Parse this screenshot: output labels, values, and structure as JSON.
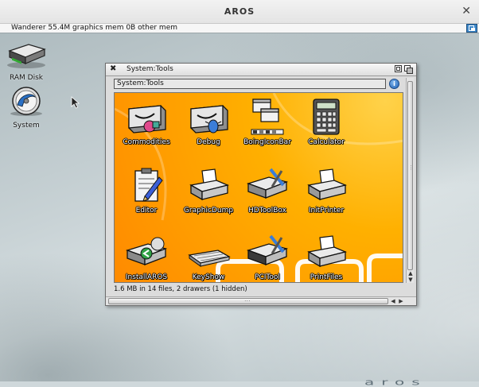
{
  "host": {
    "title": "AROS",
    "close_glyph": "✕"
  },
  "screenbar": {
    "text": "Wanderer 55.4M graphics mem 0B other mem",
    "depth_icon": "screen-depth-icon"
  },
  "desktop": {
    "icons": [
      {
        "label": "RAM Disk",
        "icon": "ram-disk-icon"
      },
      {
        "label": "System",
        "icon": "system-drive-icon"
      }
    ]
  },
  "window": {
    "title": "System:Tools",
    "path": "System:Tools",
    "close_glyph": "✖",
    "info_glyph": "i",
    "status": "1.6 MB in 14 files, 2 drawers (1 hidden)",
    "icons": [
      {
        "label": "Commodities",
        "icon": "drawer-icon"
      },
      {
        "label": "Debug",
        "icon": "drawer-icon"
      },
      {
        "label": "BoingIconBar",
        "icon": "boingiconbar-icon"
      },
      {
        "label": "Calculator",
        "icon": "calculator-icon"
      },
      {
        "label": "Editor",
        "icon": "editor-icon"
      },
      {
        "label": "GraphicDump",
        "icon": "printer-icon"
      },
      {
        "label": "HDToolBox",
        "icon": "hdtoolbox-icon"
      },
      {
        "label": "InitPrinter",
        "icon": "printer-icon"
      },
      {
        "label": "InstallAROS",
        "icon": "install-icon"
      },
      {
        "label": "KeyShow",
        "icon": "keyboard-icon"
      },
      {
        "label": "PCITool",
        "icon": "hdtoolbox-icon"
      },
      {
        "label": "PrintFiles",
        "icon": "printer-icon"
      }
    ],
    "scroll": {
      "up": "▲",
      "down": "▼",
      "left": "◀",
      "right": "▶"
    }
  },
  "brand": {
    "logo_text": "aros"
  }
}
